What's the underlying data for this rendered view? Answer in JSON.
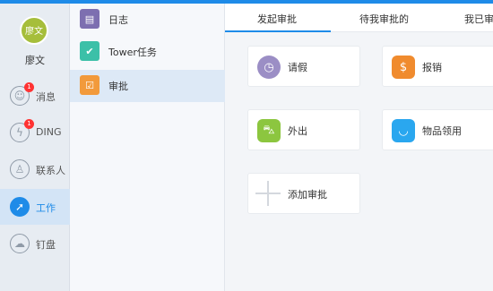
{
  "user": {
    "avatar_text": "廖文",
    "name": "廖文"
  },
  "nav": {
    "items": [
      {
        "label": "消息",
        "badge": "1"
      },
      {
        "label": "DING",
        "badge": "1"
      },
      {
        "label": "联系人"
      },
      {
        "label": "工作"
      },
      {
        "label": "钉盘"
      }
    ]
  },
  "subnav": {
    "items": [
      {
        "label": "日志"
      },
      {
        "label": "Tower任务"
      },
      {
        "label": "审批"
      }
    ]
  },
  "tabs": [
    {
      "label": "发起审批"
    },
    {
      "label": "待我审批的"
    },
    {
      "label": "我已审"
    }
  ],
  "cards": [
    {
      "label": "请假"
    },
    {
      "label": "报销"
    },
    {
      "label": "外出"
    },
    {
      "label": "物品领用"
    },
    {
      "label": "添加审批"
    }
  ],
  "colors": {
    "accent": "#1e8be8",
    "avatar": "#a6be3b",
    "badge": "#ff3333"
  }
}
